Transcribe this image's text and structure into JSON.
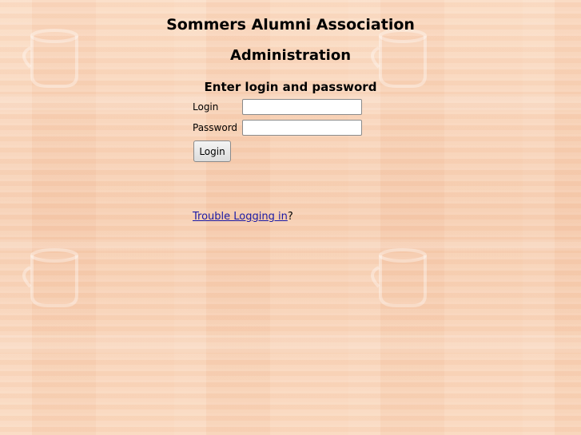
{
  "header": {
    "site_title": "Sommers Alumni Association",
    "section_title": "Administration"
  },
  "login_form": {
    "heading": "Enter login and password",
    "login_label": "Login",
    "login_value": "",
    "password_label": "Password",
    "password_value": "",
    "submit_label": "Login"
  },
  "help": {
    "link_text": "Trouble Logging in",
    "suffix": "?"
  },
  "colors": {
    "background": "#f8d4b8",
    "link": "#1a1aa6"
  }
}
